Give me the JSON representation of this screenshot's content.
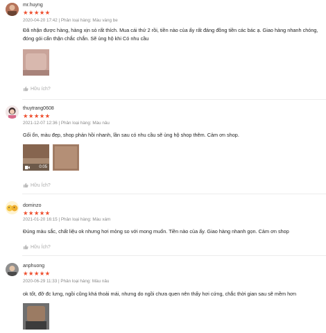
{
  "reviews": [
    {
      "username": "mr.huyng",
      "stars": "★★★★★",
      "meta": "2020-04-20 17:42 | Phân loại hàng: Màu vàng be",
      "comment": "Đã nhận được hàng, hàng xịn sò rất thích. Mua cái thứ 2 rồi, tiền nào của ấy rất đáng đồng tiền các bác ạ. Giao hàng nhanh chóng, đóng gói cẩn thận chắc chắn. Sẽ ủng hộ khi Có nhu cầu",
      "helpful": "Hữu ích?"
    },
    {
      "username": "thuytrang0608",
      "stars": "★★★★★",
      "meta": "2021-12-07 12:36 | Phân loại hàng: Màu nâu",
      "comment": "Gối ổn, màu đẹp, shop phản hồi nhanh, lần sau có nhu cầu sẽ ủng hộ shop thêm. Cảm ơn shop.",
      "video_duration": "0:05",
      "helpful": "Hữu Ích?"
    },
    {
      "username": "dominzo",
      "stars": "★★★★★",
      "meta": "2021-01-20 16:15 | Phân loại hàng: Màu xám",
      "comment": "Đúng màu sắc, chất liệu ok nhưng hơi mỏng so với mong muốn. Tiền nào của ấy. Giao hàng nhanh gọn. Cảm ơn shop",
      "helpful": "Hữu Ích?"
    },
    {
      "username": "anphuong",
      "stars": "★★★★★",
      "meta": "2020-06-29 11:33 | Phân loại hàng: Màu nâu",
      "comment": "ok tốt, đỡ đc lưng, ngồi cũng khá thoải mái, nhưng do ngồi chưa quen nên thấy hơi cứng, chắc thời gian sau sẽ mềm hơn"
    }
  ],
  "colors": {
    "star": "#ee4d2d",
    "meta": "#888888",
    "helpful": "#aaaaaa"
  }
}
